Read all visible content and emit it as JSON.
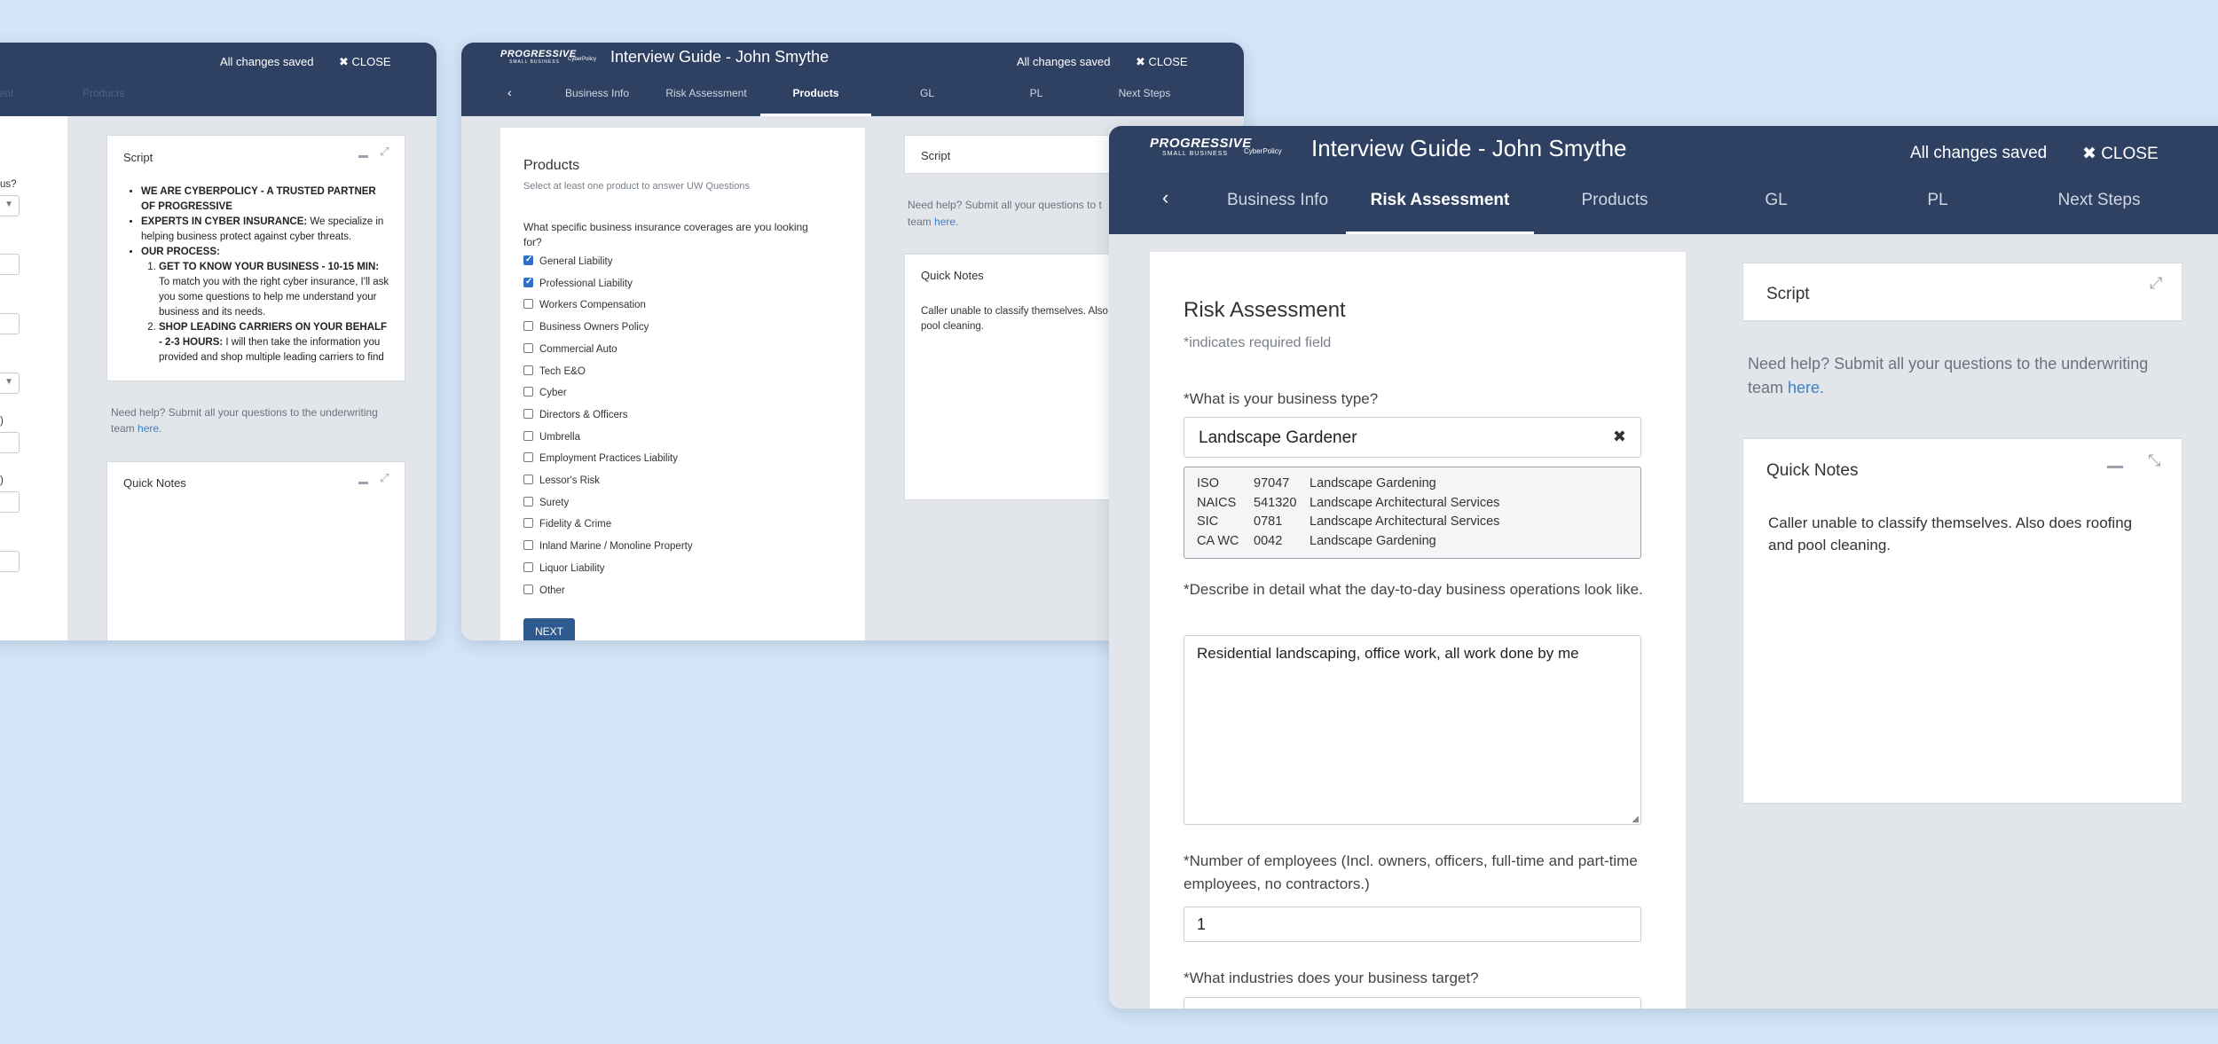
{
  "colors": {
    "header": "#2e4163",
    "background": "#d3e5f7",
    "link": "#3f7fc6",
    "button": "#2f5a8f"
  },
  "brand": {
    "logo_main": "PROGRESSIVE",
    "logo_sub": "SMALL BUSINESS",
    "partner": "CyberPolicy"
  },
  "win1": {
    "saved": "All changes saved",
    "close": "CLOSE",
    "tab_faded_1": "essment",
    "tab_faded_2": "Products",
    "left_fragment_1": "us?",
    "left_fragment_2": ")",
    "left_fragment_3": ")",
    "script": {
      "title": "Script",
      "bullet1_bold": "WE ARE CYBERPOLICY - A TRUSTED PARTNER OF PROGRESSIVE",
      "bullet2_bold": "EXPERTS IN CYBER INSURANCE:",
      "bullet2_text": " We specialize in helping business protect against cyber threats.",
      "bullet3_bold": "OUR PROCESS:",
      "sub1_bold": "GET TO KNOW YOUR BUSINESS - 10-15 MIN:",
      "sub1_text": " To match you with the right cyber insurance, I'll ask you some questions to help me understand your business and its needs.",
      "sub2_bold": "SHOP LEADING CARRIERS ON YOUR BEHALF - 2-3 HOURS:",
      "sub2_text": " I will then take the information you provided and shop multiple leading carriers to find"
    },
    "help_text": "Need help? Submit all your questions to the underwriting team ",
    "help_link": "here.",
    "notes_title": "Quick Notes"
  },
  "win2": {
    "title": "Interview Guide - John Smythe",
    "saved": "All changes saved",
    "close": "CLOSE",
    "tabs": [
      "Business Info",
      "Risk Assessment",
      "Products",
      "GL",
      "PL",
      "Next Steps"
    ],
    "products": {
      "heading": "Products",
      "sub": "Select at least one product to answer UW Questions",
      "question": "What specific business insurance coverages are you looking for?",
      "options": [
        {
          "label": "General Liability",
          "checked": true
        },
        {
          "label": "Professional Liability",
          "checked": true
        },
        {
          "label": "Workers Compensation",
          "checked": false
        },
        {
          "label": "Business Owners Policy",
          "checked": false
        },
        {
          "label": "Commercial Auto",
          "checked": false
        },
        {
          "label": "Tech E&O",
          "checked": false
        },
        {
          "label": "Cyber",
          "checked": false
        },
        {
          "label": "Directors & Officers",
          "checked": false
        },
        {
          "label": "Umbrella",
          "checked": false
        },
        {
          "label": "Employment Practices Liability",
          "checked": false
        },
        {
          "label": "Lessor's Risk",
          "checked": false
        },
        {
          "label": "Surety",
          "checked": false
        },
        {
          "label": "Fidelity & Crime",
          "checked": false
        },
        {
          "label": "Inland Marine / Monoline Property",
          "checked": false
        },
        {
          "label": "Liquor Liability",
          "checked": false
        },
        {
          "label": "Other",
          "checked": false
        }
      ],
      "next": "NEXT"
    },
    "script_title": "Script",
    "help_text": "Need help? Submit all your questions to t",
    "help_text2": "team ",
    "help_link": "here.",
    "notes_title": "Quick Notes",
    "notes_text": "Caller unable to classify themselves. Also and pool cleaning."
  },
  "win3": {
    "title": "Interview Guide - John Smythe",
    "saved": "All changes saved",
    "close": "CLOSE",
    "tabs": [
      "Business Info",
      "Risk Assessment",
      "Products",
      "GL",
      "PL",
      "Next Steps"
    ],
    "form": {
      "heading": "Risk Assessment",
      "required_note": "*indicates required field",
      "q_business_type": "*What is your business type?",
      "business_type_value": "Landscape Gardener",
      "classifications": [
        {
          "code_type": "ISO",
          "code": "97047",
          "desc": "Landscape Gardening"
        },
        {
          "code_type": "NAICS",
          "code": "541320",
          "desc": "Landscape Architectural Services"
        },
        {
          "code_type": "SIC",
          "code": "0781",
          "desc": "Landscape Architectural Services"
        },
        {
          "code_type": "CA WC",
          "code": "0042",
          "desc": "Landscape Gardening"
        }
      ],
      "q_operations": "*Describe in detail what the day-to-day business operations look like.",
      "operations_value": "Residential landscaping, office work, all work done by me",
      "q_employees": "*Number of employees (Incl. owners, officers, full-time and part-time employees, no contractors.)",
      "employees_value": "1",
      "q_industries": "*What industries does your business target?"
    },
    "script_title": "Script",
    "help_text": "Need help? Submit all your questions to the underwriting team ",
    "help_link": "here.",
    "notes_title": "Quick Notes",
    "notes_text": "Caller unable to classify themselves. Also does roofing and pool cleaning."
  }
}
